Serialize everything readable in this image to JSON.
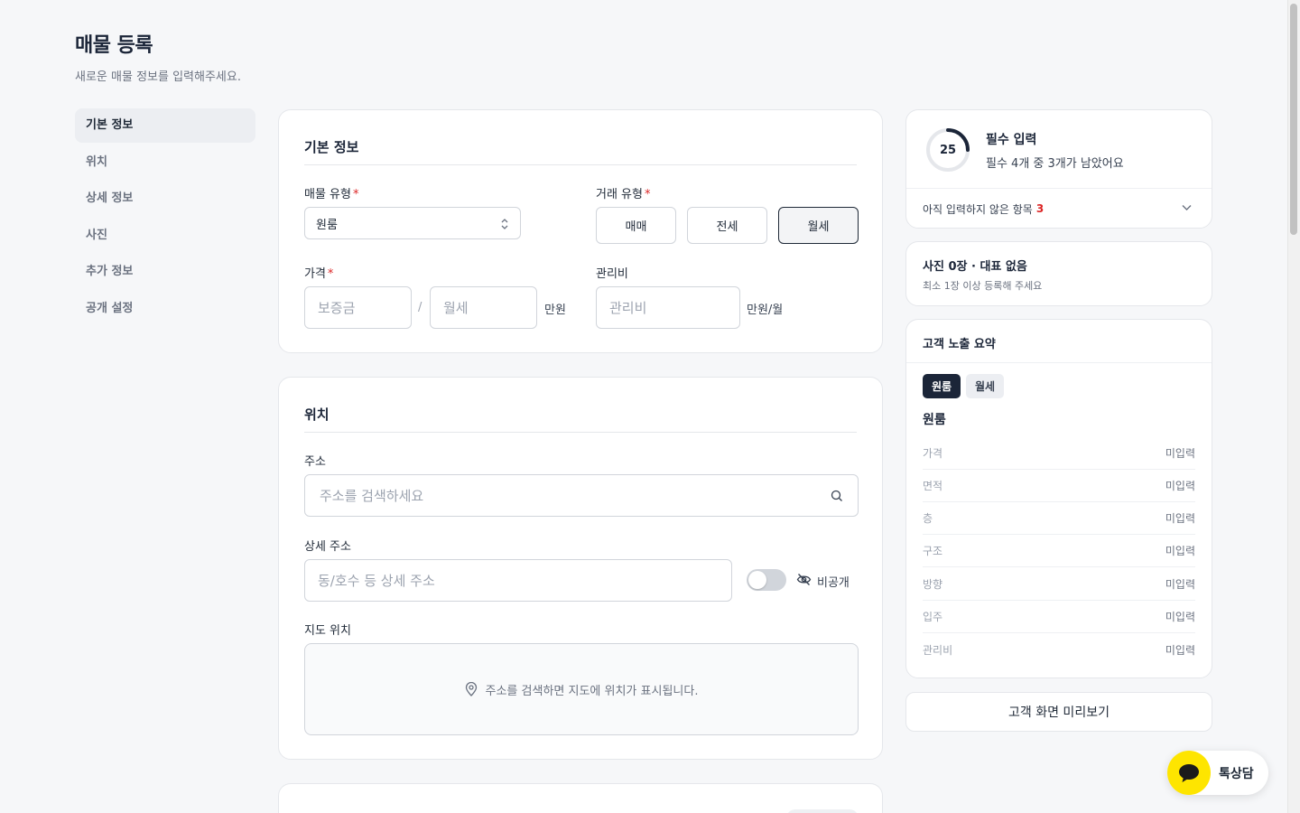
{
  "header": {
    "title": "매물 등록",
    "subtitle": "새로운 매물 정보를 입력해주세요."
  },
  "nav": {
    "items": [
      {
        "label": "기본 정보",
        "active": true
      },
      {
        "label": "위치"
      },
      {
        "label": "상세 정보"
      },
      {
        "label": "사진"
      },
      {
        "label": "추가 정보"
      },
      {
        "label": "공개 설정"
      }
    ]
  },
  "basic": {
    "title": "기본 정보",
    "property_type_label": "매물 유형",
    "property_type_value": "원룸",
    "deal_type_label": "거래 유형",
    "deal_types": [
      "매매",
      "전세",
      "월세"
    ],
    "deal_type_selected": "월세",
    "price_label": "가격",
    "deposit_placeholder": "보증금",
    "slash": "/",
    "monthly_placeholder": "월세",
    "price_unit": "만원",
    "fee_label": "관리비",
    "fee_placeholder": "관리비",
    "fee_unit": "만원/월",
    "required_mark": "*"
  },
  "location": {
    "title": "위치",
    "address_label": "주소",
    "address_placeholder": "주소를 검색하세요",
    "detail_label": "상세 주소",
    "detail_placeholder": "동/호수 등 상세 주소",
    "private_label": "비공개",
    "map_label": "지도 위치",
    "map_hint": "주소를 검색하면 지도에 위치가 표시됩니다."
  },
  "progress": {
    "value": 25,
    "title": "필수 입력",
    "subtitle": "필수 4개 중 3개가 남았어요",
    "missing_label": "아직 입력하지 않은 항목",
    "missing_count": "3"
  },
  "photo": {
    "title": "사진 0장 · 대표 없음",
    "subtitle": "최소 1장 이상 등록해 주세요"
  },
  "summary": {
    "title": "고객 노출 요약",
    "chips": [
      "원룸",
      "월세"
    ],
    "heading": "원룸",
    "rows": [
      {
        "k": "가격",
        "v": "미입력"
      },
      {
        "k": "면적",
        "v": "미입력"
      },
      {
        "k": "층",
        "v": "미입력"
      },
      {
        "k": "구조",
        "v": "미입력"
      },
      {
        "k": "방향",
        "v": "미입력"
      },
      {
        "k": "입주",
        "v": "미입력"
      },
      {
        "k": "관리비",
        "v": "미입력"
      }
    ]
  },
  "preview_button": "고객 화면 미리보기",
  "chat": {
    "label": "톡상담"
  },
  "colors": {
    "accent": "#1b2538",
    "required": "#dc2626",
    "chat_yellow": "#fee500"
  }
}
